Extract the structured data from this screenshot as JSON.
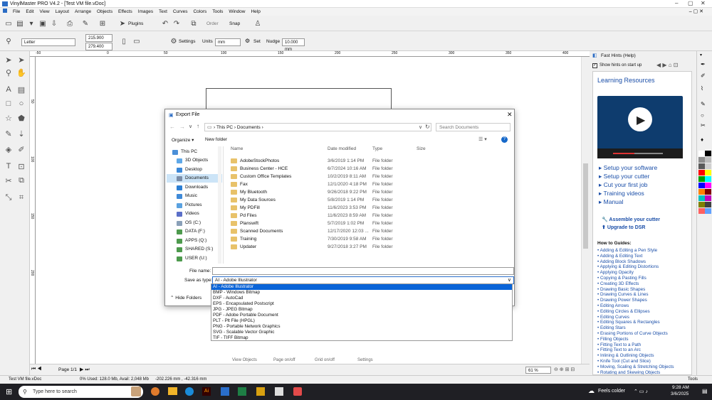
{
  "window": {
    "title": "VinylMaster PRO V4.2 - [Test VM file.vDoc]"
  },
  "menu": [
    "File",
    "Edit",
    "View",
    "Layout",
    "Arrange",
    "Objects",
    "Effects",
    "Images",
    "Text",
    "Curves",
    "Colors",
    "Tools",
    "Window",
    "Help"
  ],
  "toolbar": {
    "plugins": "Plugins",
    "order": "Order",
    "snap": "Snap"
  },
  "props": {
    "page_size": "Letter",
    "width": "215.900 mm",
    "height": "279.400 mm",
    "settings": "Settings",
    "units_label": "Units",
    "units_value": "mm",
    "set": "Set",
    "nudge_label": "Nudge",
    "nudge_value": "10.000 mm"
  },
  "ruler": {
    "h_ticks": [
      "-50",
      "0",
      "50",
      "100",
      "150",
      "200",
      "250",
      "300",
      "350",
      "400"
    ],
    "v_ticks": [
      "50",
      "100",
      "150",
      "200"
    ]
  },
  "hints": {
    "title": "Fast Hints (Help)",
    "show_on_startup": "Show hints on start up",
    "learning_title": "Learning Resources",
    "links": [
      "Setup your software",
      "Setup your cutter",
      "Cut your first job",
      "Training videos",
      "Manual"
    ],
    "assemble": "Assemble your cutter",
    "upgrade": "Upgrade to DSR",
    "guides_title": "How to Guides:",
    "guides": [
      "Adding & Editing a Pen Style",
      "Adding & Editing Text",
      "Adding Block Shadows",
      "Applying & Editing Distortions",
      "Applying Opacity",
      "Copying & Pasting Fills",
      "Creating 3D Effects",
      "Drawing Basic Shapes",
      "Drawing Curves & Lines",
      "Drawing Power Shapes",
      "Editing Arrows",
      "Editing Circles & Ellipses",
      "Editing Curves",
      "Editing Squares & Rectangles",
      "Editing Stars",
      "Erasing Portions of Curve Objects",
      "Filling Objects",
      "Fitting Text to a Path",
      "Fitting Text to an Arc",
      "Inlining & Outlining Objects",
      "Knife Tool (Cut and Slice)",
      "Moving, Scaling & Stretching Objects",
      "Rotating and Skewing Objects"
    ]
  },
  "dialog": {
    "title": "Export File",
    "breadcrumb": [
      "This PC",
      "Documents"
    ],
    "search_placeholder": "Search Documents",
    "organize": "Organize",
    "new_folder": "New folder",
    "nav": [
      "This PC",
      "3D Objects",
      "Desktop",
      "Documents",
      "Downloads",
      "Music",
      "Pictures",
      "Videos",
      "OS (C:)",
      "DATA (F:)",
      "APPS (Q:)",
      "SHARED (S:)",
      "USER (U:)"
    ],
    "columns": [
      "Name",
      "Date modified",
      "Type",
      "Size"
    ],
    "files": [
      {
        "name": "AdobeStockPhotos",
        "date": "3/6/2019 1:14 PM",
        "type": "File folder"
      },
      {
        "name": "Business Center - HCE",
        "date": "6/7/2024 10:16 AM",
        "type": "File folder"
      },
      {
        "name": "Custom Office Templates",
        "date": "10/2/2019 8:11 AM",
        "type": "File folder"
      },
      {
        "name": "Fax",
        "date": "12/1/2020 4:18 PM",
        "type": "File folder"
      },
      {
        "name": "My Bluetooth",
        "date": "9/26/2018 9:22 PM",
        "type": "File folder"
      },
      {
        "name": "My Data Sources",
        "date": "5/8/2019 1:14 PM",
        "type": "File folder"
      },
      {
        "name": "My PDFill",
        "date": "11/6/2023 3:53 PM",
        "type": "File folder"
      },
      {
        "name": "Pd Files",
        "date": "11/6/2023 8:59 AM",
        "type": "File folder"
      },
      {
        "name": "Planswift",
        "date": "5/7/2019 1:02 PM",
        "type": "File folder"
      },
      {
        "name": "Scanned Documents",
        "date": "12/17/2020 12:03 ...",
        "type": "File folder"
      },
      {
        "name": "Training",
        "date": "7/30/2019 9:58 AM",
        "type": "File folder"
      },
      {
        "name": "Updater",
        "date": "9/27/2018 3:27 PM",
        "type": "File folder"
      }
    ],
    "file_name_label": "File name:",
    "file_name_value": "",
    "save_type_label": "Save as type:",
    "save_type_value": "AI - Adobe Illustrator",
    "hide_folders": "Hide Folders",
    "type_options": [
      "AI - Adobe Illustrator",
      "BMP - Windows Bitmap",
      "DXF - AutoCad",
      "EPS - Encapsulated Postscript",
      "JPG - JPEG Bitmap",
      "PDF - Adobe Portable Document",
      "PLT - Plt File (HPGL)",
      "PNG - Portable Network Graphics",
      "SVG - Scalable Vector Graphic",
      "TIF - TIFF Bitmap"
    ]
  },
  "bottom": {
    "page": "Page 1/1",
    "zoom": "61 %",
    "view_objects": "View Objects",
    "page_onoff": "Page on/off",
    "grid_onoff": "Grid on/off",
    "settings": "Settings"
  },
  "status": {
    "file": "Test VM file.vDoc",
    "mem": "0%   Used: 128.0 Mb, Avail: 2,048 Mb",
    "coords": "-202.226 mm , -42.316 mm",
    "tools": "Tools"
  },
  "taskbar": {
    "search": "Type here to search",
    "weather": "Feels colder",
    "time": "9:28 AM",
    "date": "3/6/2025"
  },
  "colors": {
    "accent": "#0a64d8",
    "folder": "#e8c26a",
    "hints_header": "#1a4ea8"
  }
}
